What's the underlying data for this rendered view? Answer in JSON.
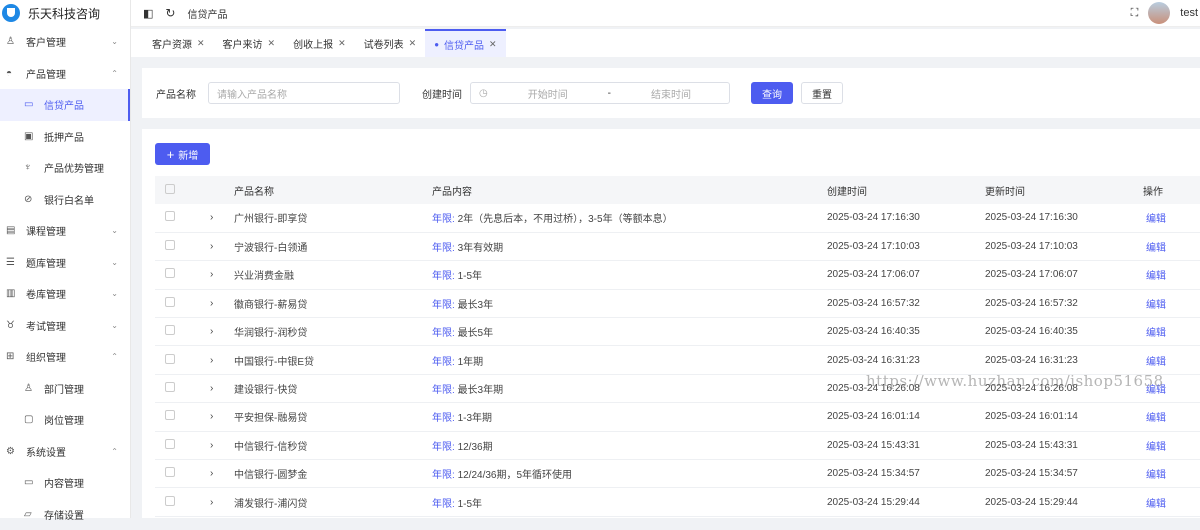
{
  "brand": "乐天科技咨询",
  "sidebar": [
    {
      "label": "客户管理",
      "icon": "user-icon",
      "level": 0,
      "chevron": "⌄"
    },
    {
      "label": "产品管理",
      "icon": "box-icon",
      "level": 0,
      "chevron": "⌃"
    },
    {
      "label": "信贷产品",
      "icon": "wallet-icon",
      "level": 1,
      "active": true
    },
    {
      "label": "抵押产品",
      "icon": "card-icon",
      "level": 1
    },
    {
      "label": "产品优势管理",
      "icon": "trophy-icon",
      "level": 1
    },
    {
      "label": "银行白名单",
      "icon": "compass-icon",
      "level": 1
    },
    {
      "label": "课程管理",
      "icon": "book-icon",
      "level": 0,
      "chevron": "⌄"
    },
    {
      "label": "题库管理",
      "icon": "list-icon",
      "level": 0,
      "chevron": "⌄"
    },
    {
      "label": "卷库管理",
      "icon": "folder-icon",
      "level": 0,
      "chevron": "⌄"
    },
    {
      "label": "考试管理",
      "icon": "medal-icon",
      "level": 0,
      "chevron": "⌄"
    },
    {
      "label": "组织管理",
      "icon": "org-icon",
      "level": 0,
      "chevron": "⌃"
    },
    {
      "label": "部门管理",
      "icon": "dept-icon",
      "level": 1
    },
    {
      "label": "岗位管理",
      "icon": "post-icon",
      "level": 1
    },
    {
      "label": "系统设置",
      "icon": "gear-icon",
      "level": 0,
      "chevron": "⌃"
    },
    {
      "label": "内容管理",
      "icon": "content-icon",
      "level": 1
    },
    {
      "label": "存储设置",
      "icon": "storage-icon",
      "level": 1
    }
  ],
  "header": {
    "breadcrumb": "信贷产品",
    "user": "test"
  },
  "tabs": [
    {
      "label": "客户资源"
    },
    {
      "label": "客户来访"
    },
    {
      "label": "创收上报"
    },
    {
      "label": "试卷列表"
    },
    {
      "label": "信贷产品",
      "active": true
    }
  ],
  "filter": {
    "name_label": "产品名称",
    "name_placeholder": "请输入产品名称",
    "time_label": "创建时间",
    "start_placeholder": "开始时间",
    "sep": "-",
    "end_placeholder": "结束时间",
    "query": "查询",
    "reset": "重置"
  },
  "add_button": "新增",
  "table": {
    "headers": [
      "产品名称",
      "产品内容",
      "创建时间",
      "更新时间",
      "操作"
    ],
    "content_prefix": "年限:",
    "action": "编辑",
    "rows": [
      {
        "name": "广州银行-即享贷",
        "content": "2年（先息后本，不用过桥），3-5年（等额本息）",
        "created": "2025-03-24 17:16:30",
        "updated": "2025-03-24 17:16:30"
      },
      {
        "name": "宁波银行-白领通",
        "content": "3年有效期",
        "created": "2025-03-24 17:10:03",
        "updated": "2025-03-24 17:10:03"
      },
      {
        "name": "兴业消费金融",
        "content": "1-5年",
        "created": "2025-03-24 17:06:07",
        "updated": "2025-03-24 17:06:07"
      },
      {
        "name": "徽商银行-薪易贷",
        "content": "最长3年",
        "created": "2025-03-24 16:57:32",
        "updated": "2025-03-24 16:57:32"
      },
      {
        "name": "华润银行-润秒贷",
        "content": "最长5年",
        "created": "2025-03-24 16:40:35",
        "updated": "2025-03-24 16:40:35"
      },
      {
        "name": "中国银行-中银E贷",
        "content": "1年期",
        "created": "2025-03-24 16:31:23",
        "updated": "2025-03-24 16:31:23"
      },
      {
        "name": "建设银行-快贷",
        "content": "最长3年期",
        "created": "2025-03-24 16:26:08",
        "updated": "2025-03-24 16:26:08"
      },
      {
        "name": "平安担保-融易贷",
        "content": "1-3年期",
        "created": "2025-03-24 16:01:14",
        "updated": "2025-03-24 16:01:14"
      },
      {
        "name": "中信银行-信秒贷",
        "content": "12/36期",
        "created": "2025-03-24 15:43:31",
        "updated": "2025-03-24 15:43:31"
      },
      {
        "name": "中信银行-圆梦金",
        "content": "12/24/36期，5年循环使用",
        "created": "2025-03-24 15:34:57",
        "updated": "2025-03-24 15:34:57"
      },
      {
        "name": "浦发银行-浦闪贷",
        "content": "1-5年",
        "created": "2025-03-24 15:29:44",
        "updated": "2025-03-24 15:29:44"
      }
    ]
  },
  "watermark": "https://www.huzhan.com/ishop51658"
}
